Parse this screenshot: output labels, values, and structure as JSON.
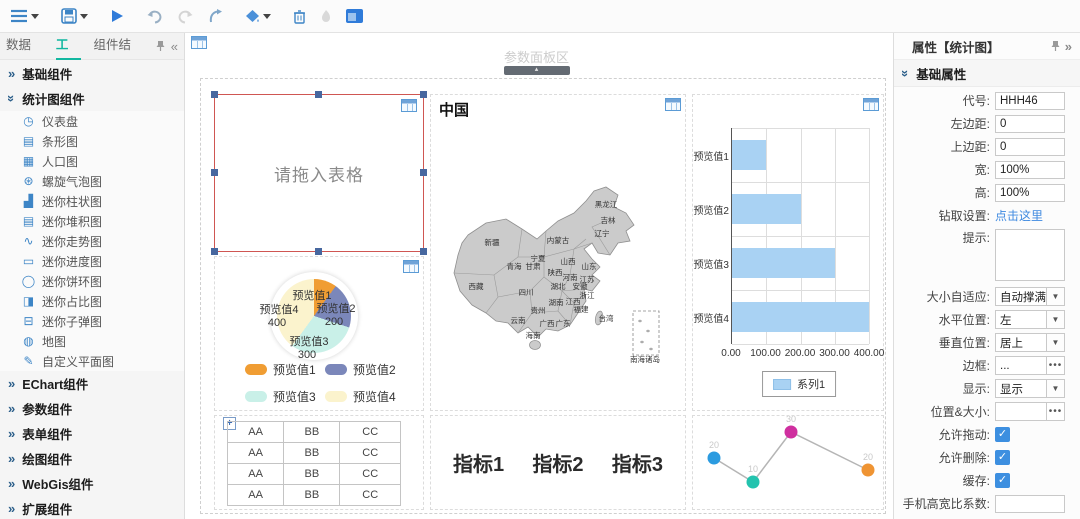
{
  "toolbar": {
    "icons": [
      "menu-icon",
      "menu-caret-icon",
      "save-icon",
      "save-caret-icon",
      "run-icon",
      "undo-icon",
      "redo-icon",
      "export-icon",
      "fill-icon",
      "fill-caret-icon",
      "trash-icon",
      "flame-icon",
      "panel-layout-icon"
    ]
  },
  "sidebar": {
    "tabs": [
      {
        "label": "数据源",
        "active": false
      },
      {
        "label": "工具",
        "active": true
      },
      {
        "label": "组件结构",
        "active": false
      }
    ],
    "sections": [
      {
        "label": "基础组件",
        "expanded": false,
        "items": []
      },
      {
        "label": "统计图组件",
        "expanded": true,
        "items": [
          {
            "icon": "gauge-icon",
            "glyph": "◷",
            "label": "仪表盘"
          },
          {
            "icon": "bar-rows-icon",
            "glyph": "▤",
            "label": "条形图"
          },
          {
            "icon": "population-icon",
            "glyph": "▦",
            "label": "人口图"
          },
          {
            "icon": "spiral-bubble-icon",
            "glyph": "⊛",
            "label": "螺旋气泡图"
          },
          {
            "icon": "mini-column-icon",
            "glyph": "▟",
            "label": "迷你柱状图"
          },
          {
            "icon": "mini-stack-icon",
            "glyph": "▤",
            "label": "迷你堆积图"
          },
          {
            "icon": "mini-trend-icon",
            "glyph": "∿",
            "label": "迷你走势图"
          },
          {
            "icon": "mini-progress-icon",
            "glyph": "▭",
            "label": "迷你进度图"
          },
          {
            "icon": "mini-donut-icon",
            "glyph": "◯",
            "label": "迷你饼环图"
          },
          {
            "icon": "mini-ratio-icon",
            "glyph": "◨",
            "label": "迷你占比图"
          },
          {
            "icon": "mini-bullet-icon",
            "glyph": "⊟",
            "label": "迷你子弹图"
          },
          {
            "icon": "map-icon",
            "glyph": "◍",
            "label": "地图"
          },
          {
            "icon": "pencil-icon",
            "glyph": "✎",
            "label": "自定义平面图"
          }
        ]
      },
      {
        "label": "EChart组件",
        "expanded": false,
        "items": []
      },
      {
        "label": "参数组件",
        "expanded": false,
        "items": []
      },
      {
        "label": "表单组件",
        "expanded": false,
        "items": []
      },
      {
        "label": "绘图组件",
        "expanded": false,
        "items": []
      },
      {
        "label": "WebGis组件",
        "expanded": false,
        "items": []
      },
      {
        "label": "扩展组件",
        "expanded": false,
        "items": []
      }
    ]
  },
  "canvas": {
    "param_label": "参数面板区",
    "placeholder_text": "请拖入表格",
    "metrics": [
      "指标1",
      "指标2",
      "指标3"
    ]
  },
  "chart_data": [
    {
      "type": "bar",
      "orientation": "horizontal",
      "categories": [
        "预览值1",
        "预览值2",
        "预览值3",
        "预览值4"
      ],
      "values": [
        100,
        200,
        300,
        400
      ],
      "xlim": [
        0,
        400
      ],
      "x_ticks": [
        "0.00",
        "100.00",
        "200.00",
        "300.00",
        "400.00"
      ],
      "grid": true,
      "legend": [
        "系列1"
      ],
      "legend_position": "bottom",
      "bar_color": "#a9d2f3"
    },
    {
      "type": "pie",
      "categories": [
        "预览值1",
        "预览值2",
        "预览值3",
        "预览值4"
      ],
      "values": [
        100,
        200,
        300,
        400
      ],
      "colors": [
        "#f09d33",
        "#7b87ba",
        "#c9f0e8",
        "#fbf3cd"
      ],
      "labels_shown": [
        {
          "text": "预览值1",
          "value": ""
        },
        {
          "text": "预览值2",
          "value": "200"
        },
        {
          "text": "预览值3",
          "value": "300"
        },
        {
          "text": "预览值4",
          "value": "400"
        }
      ],
      "legend_position": "bottom"
    },
    {
      "type": "line",
      "values": [
        20,
        10,
        30,
        20
      ],
      "labels": [
        "20",
        "10",
        "30",
        "20"
      ],
      "point_colors": [
        "#2b9be0",
        "#23c3ae",
        "#cf2f9f",
        "#ef9433"
      ],
      "line_color": "#b5b5b5"
    },
    {
      "type": "table",
      "rows": [
        [
          "AA",
          "BB",
          "CC"
        ],
        [
          "AA",
          "BB",
          "CC"
        ],
        [
          "AA",
          "BB",
          "CC"
        ],
        [
          "AA",
          "BB",
          "CC"
        ]
      ]
    },
    {
      "type": "map",
      "title": "中国",
      "labels": [
        {
          "t": "黑龙江",
          "x": 172,
          "y": 28
        },
        {
          "t": "吉林",
          "x": 174,
          "y": 44
        },
        {
          "t": "辽宁",
          "x": 168,
          "y": 57
        },
        {
          "t": "新疆",
          "x": 58,
          "y": 66
        },
        {
          "t": "内蒙古",
          "x": 124,
          "y": 64
        },
        {
          "t": "宁夏",
          "x": 104,
          "y": 82
        },
        {
          "t": "山西",
          "x": 134,
          "y": 85
        },
        {
          "t": "青海",
          "x": 80,
          "y": 90
        },
        {
          "t": "甘肃",
          "x": 99,
          "y": 90
        },
        {
          "t": "山东",
          "x": 155,
          "y": 90
        },
        {
          "t": "陕西",
          "x": 121,
          "y": 96
        },
        {
          "t": "河南",
          "x": 136,
          "y": 101
        },
        {
          "t": "江苏",
          "x": 153,
          "y": 103
        },
        {
          "t": "西藏",
          "x": 42,
          "y": 110
        },
        {
          "t": "四川",
          "x": 92,
          "y": 116
        },
        {
          "t": "湖北",
          "x": 124,
          "y": 110
        },
        {
          "t": "安徽",
          "x": 146,
          "y": 110
        },
        {
          "t": "浙江",
          "x": 153,
          "y": 119
        },
        {
          "t": "湖南",
          "x": 122,
          "y": 126
        },
        {
          "t": "江西",
          "x": 139,
          "y": 125
        },
        {
          "t": "贵州",
          "x": 104,
          "y": 134
        },
        {
          "t": "福建",
          "x": 147,
          "y": 133
        },
        {
          "t": "云南",
          "x": 84,
          "y": 144
        },
        {
          "t": "广西",
          "x": 113,
          "y": 147
        },
        {
          "t": "广东",
          "x": 129,
          "y": 147
        },
        {
          "t": "台湾",
          "x": 172,
          "y": 142
        },
        {
          "t": "海南",
          "x": 99,
          "y": 159
        },
        {
          "t": "南海诸岛",
          "x": 211,
          "y": 183
        }
      ]
    }
  ],
  "properties": {
    "title": "属性【统计图】",
    "section": "基础属性",
    "rows": [
      {
        "label": "代号:",
        "type": "input",
        "value": "HHH46"
      },
      {
        "label": "左边距:",
        "type": "input",
        "value": "0"
      },
      {
        "label": "上边距:",
        "type": "input",
        "value": "0"
      },
      {
        "label": "宽:",
        "type": "input",
        "value": "100%"
      },
      {
        "label": "高:",
        "type": "input",
        "value": "100%"
      },
      {
        "label": "钻取设置:",
        "type": "link",
        "value": "点击这里"
      },
      {
        "label": "提示:",
        "type": "textarea",
        "value": ""
      },
      {
        "label": "大小自适应:",
        "type": "select",
        "value": "自动撑满"
      },
      {
        "label": "水平位置:",
        "type": "select",
        "value": "左"
      },
      {
        "label": "垂直位置:",
        "type": "select",
        "value": "居上"
      },
      {
        "label": "边框:",
        "type": "ellipsis",
        "value": "..."
      },
      {
        "label": "显示:",
        "type": "select",
        "value": "显示"
      },
      {
        "label": "位置&大小:",
        "type": "ellipsis",
        "value": ""
      },
      {
        "label": "允许拖动:",
        "type": "checkbox",
        "checked": true
      },
      {
        "label": "允许删除:",
        "type": "checkbox",
        "checked": true
      },
      {
        "label": "缓存:",
        "type": "checkbox",
        "checked": true
      },
      {
        "label": "手机高宽比系数:",
        "type": "input",
        "value": ""
      }
    ]
  }
}
